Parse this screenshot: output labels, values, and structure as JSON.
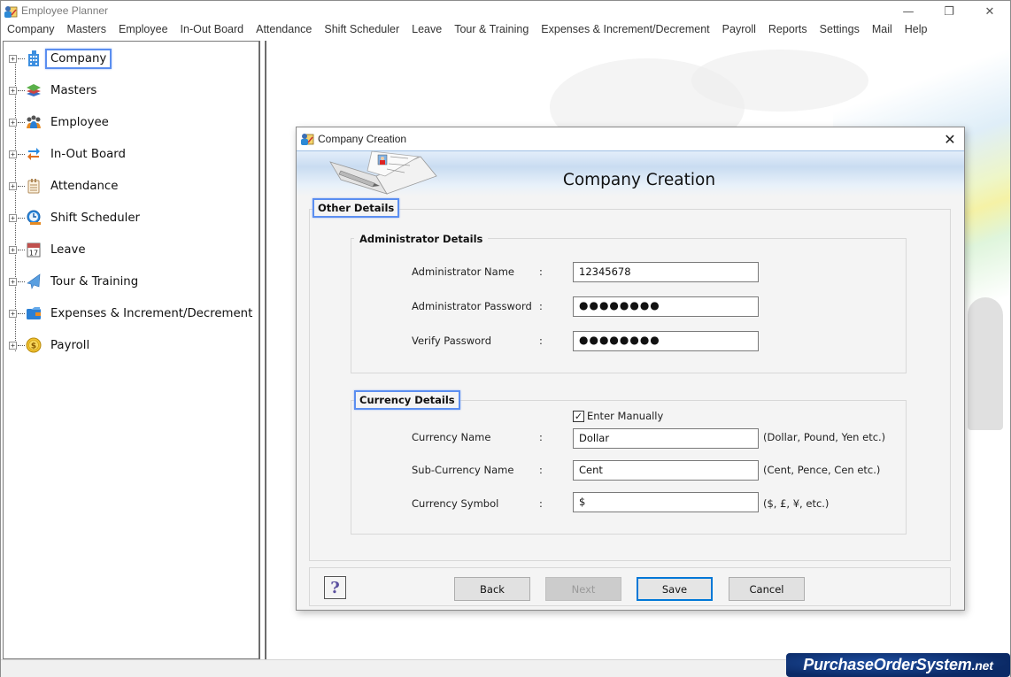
{
  "app": {
    "title": "Employee Planner",
    "window_controls": {
      "minimize": "—",
      "maximize": "❐",
      "close": "✕"
    }
  },
  "menu": {
    "items": [
      "Company",
      "Masters",
      "Employee",
      "In-Out Board",
      "Attendance",
      "Shift Scheduler",
      "Leave",
      "Tour & Training",
      "Expenses & Increment/Decrement",
      "Payroll",
      "Reports",
      "Settings",
      "Mail",
      "Help"
    ]
  },
  "tree": {
    "expander": "+",
    "items": [
      {
        "label": "Company",
        "icon": "building-icon",
        "selected": true
      },
      {
        "label": "Masters",
        "icon": "layers-icon",
        "selected": false
      },
      {
        "label": "Employee",
        "icon": "people-icon",
        "selected": false
      },
      {
        "label": "In-Out Board",
        "icon": "swap-arrows-icon",
        "selected": false
      },
      {
        "label": "Attendance",
        "icon": "clipboard-icon",
        "selected": false
      },
      {
        "label": "Shift Scheduler",
        "icon": "clock-icon",
        "selected": false
      },
      {
        "label": "Leave",
        "icon": "calendar-icon",
        "selected": false
      },
      {
        "label": "Tour & Training",
        "icon": "airplane-icon",
        "selected": false
      },
      {
        "label": "Expenses & Increment/Decrement",
        "icon": "wallet-icon",
        "selected": false
      },
      {
        "label": "Payroll",
        "icon": "dollar-coin-icon",
        "selected": false
      }
    ],
    "calendar_day": "17",
    "coin_symbol": "$"
  },
  "dialog": {
    "title": "Company Creation",
    "close": "✕",
    "banner_title": "Company Creation",
    "other_details_legend": "Other Details",
    "admin": {
      "legend": "Administrator Details",
      "fields": [
        {
          "label": "Administrator Name",
          "value": "12345678",
          "type": "text"
        },
        {
          "label": "Administrator Password",
          "value": "●●●●●●●●",
          "type": "password"
        },
        {
          "label": "Verify Password",
          "value": "●●●●●●●●",
          "type": "password"
        }
      ]
    },
    "currency": {
      "legend": "Currency Details",
      "enter_manually_label": "Enter Manually",
      "enter_manually_checked": true,
      "check_mark": "✓",
      "fields": [
        {
          "label": "Currency Name",
          "value": "Dollar",
          "hint": "(Dollar, Pound, Yen etc.)"
        },
        {
          "label": "Sub-Currency Name",
          "value": "Cent",
          "hint": "(Cent, Pence, Cen etc.)"
        },
        {
          "label": "Currency Symbol",
          "value": "$",
          "hint": "($, £, ¥, etc.)"
        }
      ]
    },
    "colon": ":",
    "buttons": {
      "help": "?",
      "back": "Back",
      "next": "Next",
      "save": "Save",
      "cancel": "Cancel"
    }
  },
  "watermark": {
    "brand": "PurchaseOrderSystem",
    "tld": ".net"
  }
}
